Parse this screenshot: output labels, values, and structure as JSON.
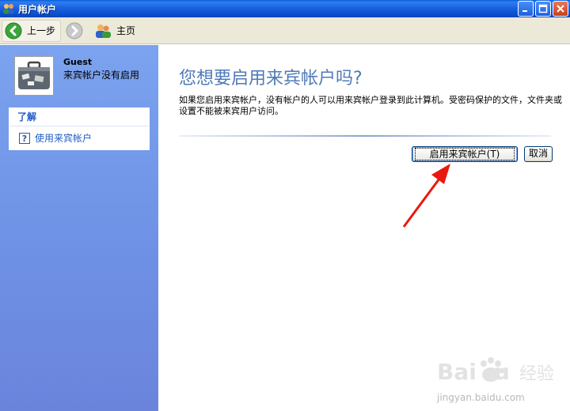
{
  "window": {
    "title": "用户帐户",
    "icon": "users-icon",
    "controls": [
      "minimize",
      "maximize",
      "close"
    ]
  },
  "toolbar": {
    "back_label": "上一步",
    "home_label": "主页"
  },
  "sidebar": {
    "user_name": "Guest",
    "user_status": "来宾帐户没有启用",
    "learn_header": "了解",
    "learn_items": [
      {
        "label": "使用来宾帐户",
        "icon": "help-icon"
      }
    ]
  },
  "main": {
    "title": "您想要启用来宾帐户吗?",
    "description": "如果您启用来宾帐户，没有帐户的人可以用来宾帐户登录到此计算机。受密码保护的文件，文件夹或设置不能被来宾用户访问。",
    "enable_button": "启用来宾帐户(T)",
    "cancel_button": "取消"
  },
  "watermark": {
    "logo_text": "Baidu经验",
    "url": "jingyan.baidu.com"
  },
  "colors": {
    "title_bar": "#0a55d6",
    "sidebar": "#7396e6",
    "heading": "#4f7ab8",
    "link": "#215dc6",
    "arrow": "#e8190f"
  }
}
